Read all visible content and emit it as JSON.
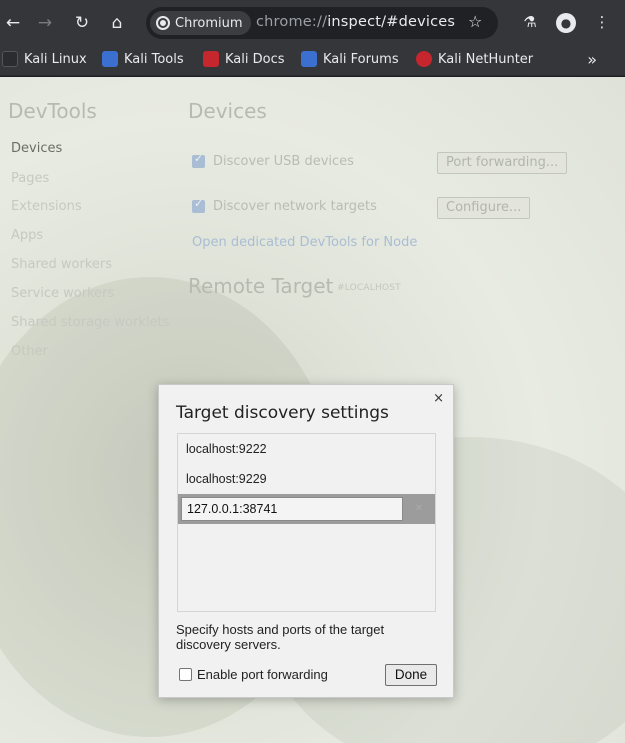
{
  "browser": {
    "nav": {
      "back": "←",
      "forward": "→",
      "reload": "↻",
      "home": "⌂"
    },
    "omnibox": {
      "chip_label": "Chromium",
      "url_scheme": "chrome://",
      "url_rest": "inspect/#devices"
    },
    "right": {
      "star": "☆",
      "labs": "⚗",
      "profile": "●",
      "menu": "⋮"
    }
  },
  "bookmarks": {
    "items": [
      {
        "label": "Kali Linux",
        "color": "#ffffff"
      },
      {
        "label": "Kali Tools",
        "color": "#3b6fd0"
      },
      {
        "label": "Kali Docs",
        "color": "#c6262e"
      },
      {
        "label": "Kali Forums",
        "color": "#3b6fd0"
      },
      {
        "label": "Kali NetHunter",
        "color": "#c6262e"
      }
    ],
    "more": "»"
  },
  "devtools": {
    "title": "DevTools",
    "sidebar": [
      "Devices",
      "Pages",
      "Extensions",
      "Apps",
      "Shared workers",
      "Service workers",
      "Shared storage worklets",
      "Other"
    ],
    "main_title": "Devices",
    "discover_usb": "Discover USB devices",
    "port_forwarding_button": "Port forwarding...",
    "discover_network": "Discover network targets",
    "configure_button": "Configure...",
    "node_link": "Open dedicated DevTools for Node",
    "remote_title": "Remote Target",
    "remote_sub": "#LOCALHOST"
  },
  "dialog": {
    "title": "Target discovery settings",
    "close": "×",
    "targets": [
      "localhost:9222",
      "localhost:9229"
    ],
    "editing_value": "127.0.0.1:38741",
    "help_text": "Specify hosts and ports of the target discovery servers.",
    "enable_port_forwarding": "Enable port forwarding",
    "done_label": "Done"
  }
}
